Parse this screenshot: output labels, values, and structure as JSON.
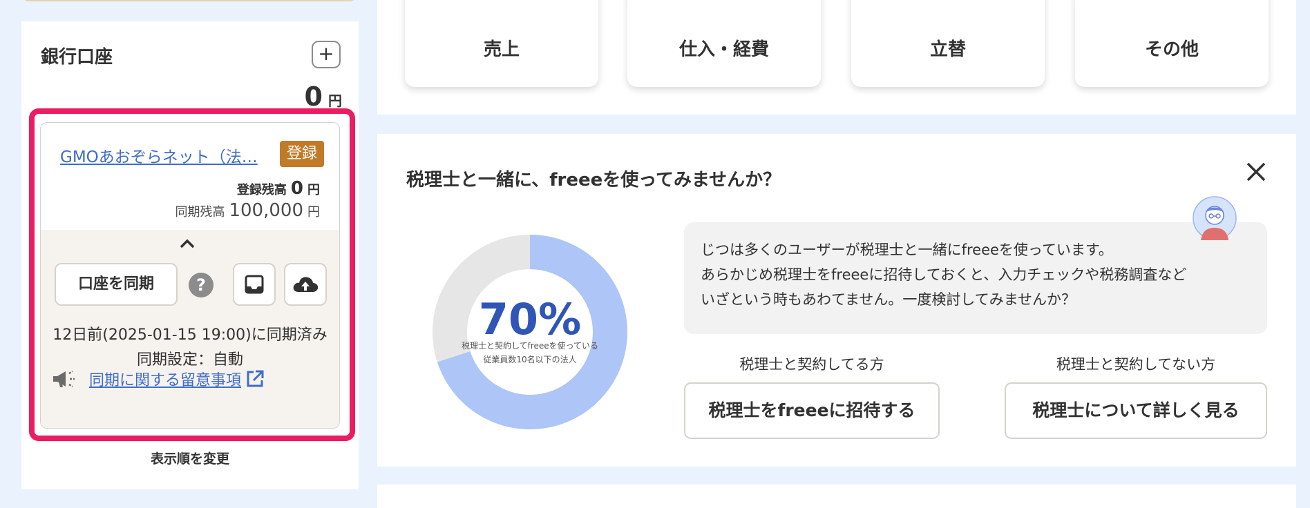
{
  "sidebar": {
    "bank_title": "銀行口座",
    "add_label": "+",
    "total_value": "0",
    "total_unit": "円",
    "account": {
      "name": "GMOあおぞらネット（法…",
      "badge": "登録",
      "registered_label": "登録残高",
      "registered_value": "0",
      "synced_label": "同期残高",
      "synced_value": "100,000",
      "unit": "円",
      "sync_button": "口座を同期",
      "help": "?",
      "sync_status": "12日前(2025-01-15 19:00)に同期済み",
      "sync_setting": "同期設定：自動",
      "notice_link": "同期に関する留意事項"
    },
    "reorder": "表示順を変更"
  },
  "categories": [
    {
      "label": "売上",
      "icon": "sales-icon"
    },
    {
      "label": "仕入・経費",
      "icon": "expense-icon"
    },
    {
      "label": "立替",
      "icon": "advance-icon"
    },
    {
      "label": "その他",
      "icon": "other-icon"
    }
  ],
  "cpa": {
    "title": "税理士と一緒に、freeeを使ってみませんか？",
    "donut_percent": "70%",
    "donut_value": 0.7,
    "donut_caption_1": "税理士と契約してfreeeを使っている",
    "donut_caption_2": "従業員数10名以下の法人",
    "bubble_lines": [
      "じつは多くのユーザーが税理士と一緒にfreeeを使っています。",
      "あらかじめ税理士をfreeeに招待しておくと、入力チェックや税務調査など",
      "いざという時もあわてません。一度検討してみませんか？"
    ],
    "option1_label": "税理士と契約してる方",
    "option1_button": "税理士をfreeeに招待する",
    "option2_label": "税理士と契約してない方",
    "option2_button": "税理士について詳しく見る"
  },
  "colors": {
    "accent_blue": "#3e6cc8",
    "donut_fill": "#adc5f7",
    "donut_track": "#e6e6e6",
    "highlight": "#ec1c61",
    "badge": "#c17a27"
  }
}
